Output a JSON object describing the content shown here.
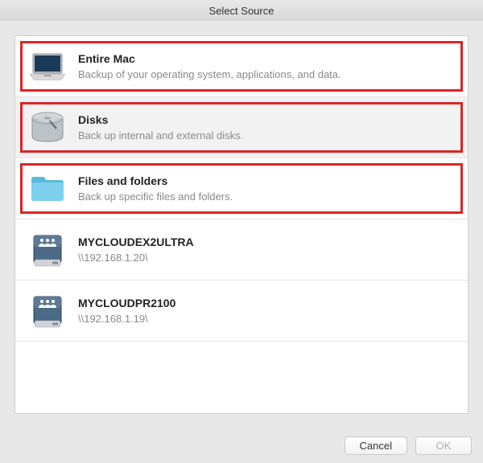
{
  "titlebar": {
    "title": "Select Source"
  },
  "sources": {
    "entireMac": {
      "title": "Entire Mac",
      "subtitle": "Backup of your operating system, applications, and data."
    },
    "disks": {
      "title": "Disks",
      "subtitle": "Back up internal and external disks."
    },
    "filesFolders": {
      "title": "Files and folders",
      "subtitle": "Back up specific files and folders."
    },
    "share1": {
      "title": "MYCLOUDEX2ULTRA",
      "subtitle": "\\\\192.168.1.20\\"
    },
    "share2": {
      "title": "MYCLOUDPR2100",
      "subtitle": "\\\\192.168.1.19\\"
    }
  },
  "footer": {
    "cancel": "Cancel",
    "ok": "OK"
  },
  "colors": {
    "highlight": "#de2424",
    "folder": "#6ec7e8",
    "drive": "#5e7a96"
  }
}
